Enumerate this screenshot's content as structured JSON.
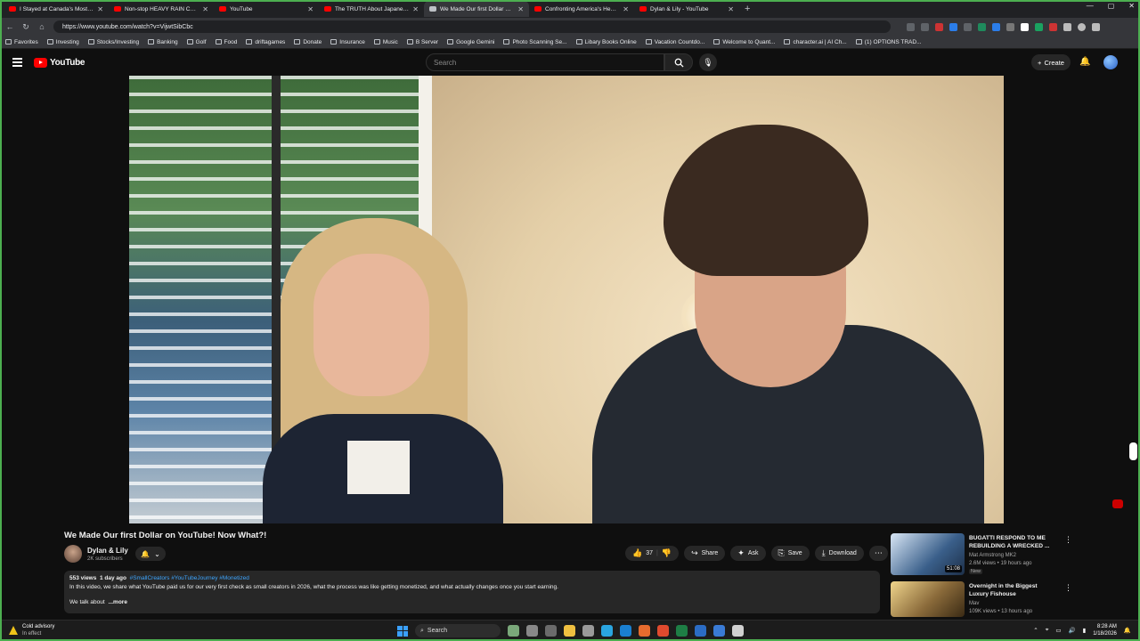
{
  "browser": {
    "tabs": [
      {
        "title": "I Stayed at Canada's Most Famous",
        "active": false
      },
      {
        "title": "Non-stop HEAVY RAIN CAMPING",
        "active": false
      },
      {
        "title": "YouTube",
        "active": false
      },
      {
        "title": "The TRUTH About Japanese Future",
        "active": false
      },
      {
        "title": "We Made Our first Dollar on YouTube",
        "active": true
      },
      {
        "title": "Confronting America's Health Epi",
        "active": false
      },
      {
        "title": "Dylan & Lily - YouTube",
        "active": false
      }
    ],
    "url": "https://www.youtube.com/watch?v=VijwtSibCbc",
    "bookmarks": [
      "Favorites",
      "Investing",
      "Stocks/Investing",
      "Banking",
      "Golf",
      "Food",
      "driftagames",
      "Donate",
      "Insurance",
      "Music",
      "B Server",
      "Google Gemini",
      "Photo Scanning Se...",
      "Libary Books Online",
      "Vacation Countdo...",
      "Welcome to Quant...",
      "character.ai | AI Ch...",
      "(1) OPTIONS TRAD..."
    ]
  },
  "youtube": {
    "logo": "YouTube",
    "search_placeholder": "Search",
    "create_label": "Create"
  },
  "video": {
    "title": "We Made Our first Dollar on YouTube! Now What?!",
    "channel": "Dylan & Lily",
    "subscribers": "2K subscribers",
    "likes": "37",
    "actions": {
      "share": "Share",
      "ask": "Ask",
      "save": "Save",
      "download": "Download"
    },
    "views": "553 views",
    "age": "1 day ago",
    "tags": "#SmallCreators #YouTubeJourney #Monetized",
    "description": "In this video, we share what YouTube paid us for our very first check as small creators in 2026, what the process was like getting monetized, and what actually changes once you start earning.",
    "description_more_prefix": "We talk about",
    "more_label": "...more"
  },
  "recommendations": [
    {
      "title": "BUGATTI RESPOND TO ME REBUILDING A WRECKED ...",
      "channel": "Mat Armstrong MK2",
      "meta": "2.6M views • 19 hours ago",
      "badge": "New",
      "duration": "51:08",
      "thumb_color": "#3a5f8a"
    },
    {
      "title": "Overnight in the Biggest Luxury Fishouse",
      "channel": "Mav",
      "meta": "109K views • 13 hours ago",
      "badge": "",
      "duration": "",
      "thumb_color": "#8a6a3a"
    }
  ],
  "taskbar": {
    "weather_title": "Cold advisory",
    "weather_sub": "In effect",
    "search_label": "Search",
    "time": "8:28 AM",
    "date": "1/18/2026"
  }
}
